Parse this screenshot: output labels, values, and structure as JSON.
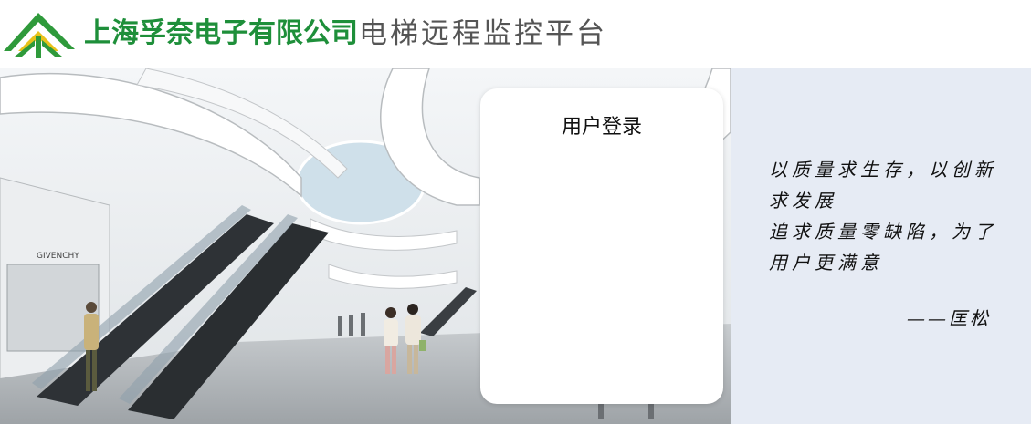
{
  "header": {
    "company_name": "上海孚奈电子有限公司",
    "platform_title": "电梯远程监控平台",
    "logo_colors": {
      "green": "#2f9a3b",
      "yellow": "#e8c21a"
    }
  },
  "hero": {
    "storefront_sign": "GIVENCHY"
  },
  "login": {
    "title": "用户登录"
  },
  "slogan": {
    "lines": [
      "以质量求生存，以创新",
      "求发展",
      "追求质量零缺陷，为了",
      "用户更满意"
    ],
    "author": "——匡松"
  }
}
